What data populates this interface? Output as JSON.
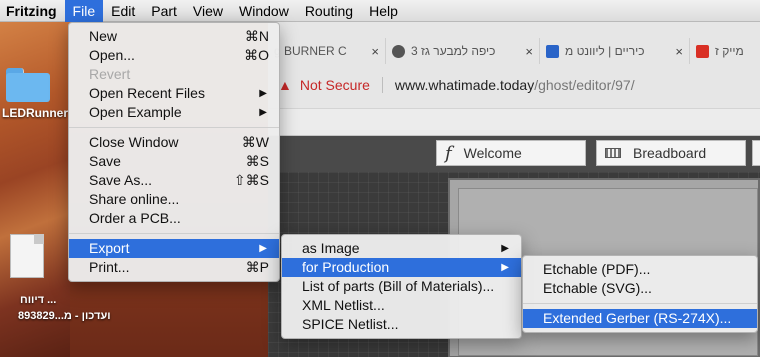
{
  "menubar": {
    "items": [
      "Fritzing",
      "File",
      "Edit",
      "Part",
      "View",
      "Window",
      "Routing",
      "Help"
    ]
  },
  "desktop": {
    "folder_label": "LEDRunner",
    "file_label_line1": "דיווח ...",
    "file_label_line2": "ועדכון - מ...893829"
  },
  "browser": {
    "tabs": [
      {
        "label": "g BURNER C",
        "close": "×"
      },
      {
        "label": "כיפה למבער גז 3",
        "close": "×"
      },
      {
        "label": "כיריים | ליוונט מ",
        "close": "×"
      },
      {
        "label": "מייק ז",
        "close": "×"
      }
    ],
    "address": {
      "warning_icon": "▲",
      "not_secure": "Not Secure",
      "host": "www.whatimade.today",
      "path": "/ghost/editor/97/"
    },
    "fritzing_tabs": {
      "welcome": "Welcome",
      "breadboard": "Breadboard"
    }
  },
  "file_menu": {
    "items": [
      {
        "label": "New",
        "shortcut": "⌘N"
      },
      {
        "label": "Open...",
        "shortcut": "⌘O"
      },
      {
        "label": "Revert",
        "shortcut": ""
      },
      {
        "label": "Open Recent Files",
        "shortcut": "▶"
      },
      {
        "label": "Open Example",
        "shortcut": "▶"
      },
      {
        "label": "Close Window",
        "shortcut": "⌘W"
      },
      {
        "label": "Save",
        "shortcut": "⌘S"
      },
      {
        "label": "Save As...",
        "shortcut": "⇧⌘S"
      },
      {
        "label": "Share online...",
        "shortcut": ""
      },
      {
        "label": "Order a PCB...",
        "shortcut": ""
      },
      {
        "label": "Export",
        "shortcut": "▶"
      },
      {
        "label": "Print...",
        "shortcut": "⌘P"
      }
    ]
  },
  "export_menu": {
    "items": [
      {
        "label": "as Image",
        "arrow": "▶"
      },
      {
        "label": "for Production",
        "arrow": "▶"
      },
      {
        "label": "List of parts (Bill of Materials)..."
      },
      {
        "label": "XML Netlist..."
      },
      {
        "label": "SPICE Netlist..."
      }
    ]
  },
  "production_menu": {
    "items": [
      {
        "label": "Etchable (PDF)..."
      },
      {
        "label": "Etchable (SVG)..."
      },
      {
        "label": "Extended Gerber (RS-274X)..."
      }
    ]
  },
  "colors": {
    "highlight": "#2e6fdc",
    "not_secure": "#c62828"
  }
}
